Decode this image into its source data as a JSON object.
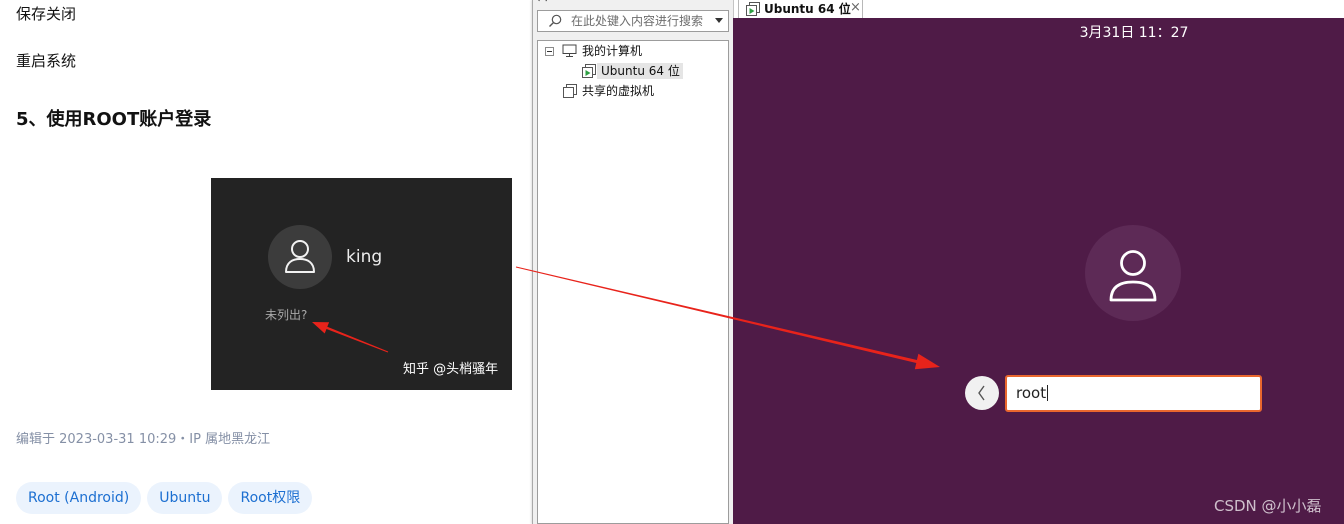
{
  "article": {
    "line1": "保存关闭",
    "line2": "重启系统",
    "heading": "5、使用ROOT账户登录",
    "embedded_image": {
      "username": "king",
      "not_listed": "未列出?",
      "watermark": "知乎 @头梢骚年"
    },
    "edited_meta": "编辑于 2023-03-31 10:29・IP 属地黑龙江",
    "tags": [
      "Root (Android)",
      "Ubuntu",
      "Root权限"
    ]
  },
  "library": {
    "title": "库",
    "close": "×",
    "search": {
      "icon": "search-icon",
      "placeholder": "在此处键入内容进行搜索"
    },
    "tree": {
      "my_computer": "我的计算机",
      "vm": "Ubuntu 64 位",
      "shared": "共享的虚拟机"
    }
  },
  "vm_tab": {
    "label": "Ubuntu 64 位",
    "close": "×"
  },
  "ubuntu_login": {
    "clock": "3月31日 11：27",
    "input_value": "root"
  },
  "watermark": "CSDN @小小磊",
  "colors": {
    "purple": "#4f1b47",
    "avatar_bg": "#5d2a56",
    "input_border": "#e9672e",
    "arrow_red": "#e8231b",
    "tag_bg": "#ebf3fd",
    "tag_text": "#1c6fd1",
    "meta_text": "#8590a6"
  }
}
